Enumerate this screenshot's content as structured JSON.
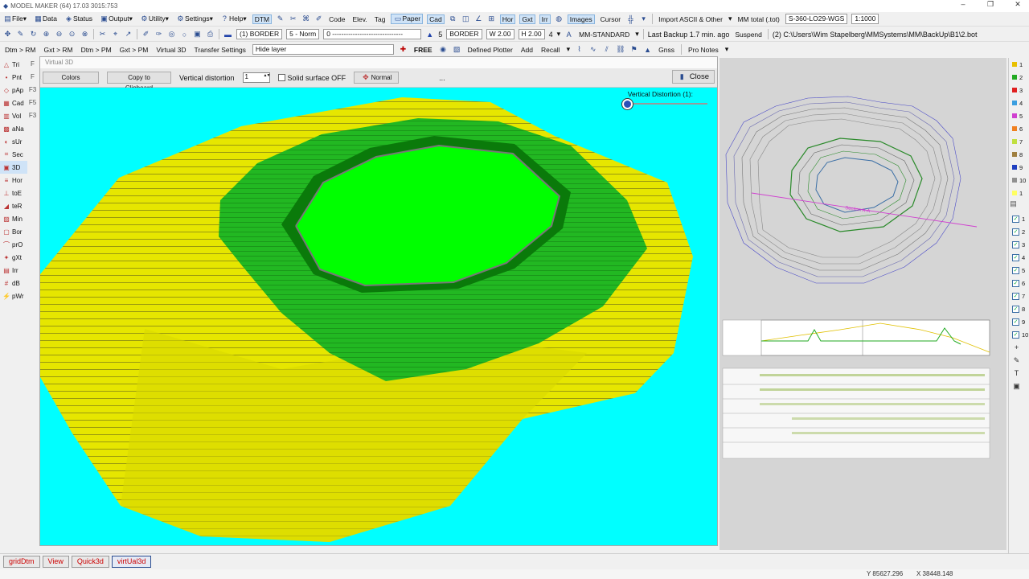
{
  "app": {
    "title": "MODEL MAKER (64)  17.03   3015:753"
  },
  "toolbar1": {
    "file": "File",
    "data": "Data",
    "status": "Status",
    "output": "Output",
    "utility": "Utility",
    "settings": "Settings",
    "help": "Help",
    "dtm": "DTM",
    "code": "Code",
    "elev": "Elev.",
    "tag": "Tag",
    "paper": "Paper",
    "cad": "Cad",
    "hor": "Hor",
    "gxt": "Gxt",
    "irr": "Irr",
    "images": "Images",
    "cursor": "Cursor",
    "import": "Import ASCII & Other",
    "mm_total": "MM total (.tot)",
    "crs": "S-360-LO29-WGS",
    "scale": "1:1000"
  },
  "toolbar2": {
    "layer_combo": "(1) BORDER",
    "style_combo": "5 - Norm",
    "line_combo": "0 -------------------------------",
    "count": "5",
    "border": "BORDER",
    "width": "W 2.00",
    "height": "H 2.00",
    "four": "4",
    "standard": "MM-STANDARD",
    "backup": "Last Backup 1.7 min. ago",
    "suspend": "Suspend",
    "path": "(2) C:\\Users\\Wim Stapelberg\\MMSystems\\MM\\BackUp\\B1\\2.bot"
  },
  "toolbar3": {
    "dtm_rm": "Dtm > RM",
    "gxt_rm": "Gxt > RM",
    "dtm_pm": "Dtm > PM",
    "gxt_pm": "Gxt > PM",
    "virtual3d": "Virtual 3D",
    "transfer": "Transfer Settings",
    "hide_layer": "Hide layer",
    "free": "FREE",
    "defined_plotter": "Defined Plotter",
    "add": "Add",
    "recall": "Recall",
    "gnss": "Gnss",
    "pro_notes": "Pro Notes"
  },
  "left_tools": [
    {
      "icon": "triangle-icon",
      "label": "Tri"
    },
    {
      "icon": "point-icon",
      "label": "Pnt"
    },
    {
      "icon": "pap-icon",
      "label": "pAp"
    },
    {
      "icon": "cad-icon",
      "label": "Cad"
    },
    {
      "icon": "volume-icon",
      "label": "Vol"
    },
    {
      "icon": "ana-icon",
      "label": "aNa"
    },
    {
      "icon": "sur-icon",
      "label": "sUr"
    },
    {
      "icon": "section-icon",
      "label": "Sec"
    },
    {
      "icon": "3d-icon",
      "label": "3D"
    },
    {
      "icon": "hor-icon",
      "label": "Hor"
    },
    {
      "icon": "toe-icon",
      "label": "toE"
    },
    {
      "icon": "ter-icon",
      "label": "teR"
    },
    {
      "icon": "min-icon",
      "label": "Min"
    },
    {
      "icon": "border-icon",
      "label": "Bor"
    },
    {
      "icon": "pro-icon",
      "label": "prO"
    },
    {
      "icon": "gxt-icon",
      "label": "gXt"
    },
    {
      "icon": "irr-icon",
      "label": "Irr"
    },
    {
      "icon": "db-icon",
      "label": "dB"
    },
    {
      "icon": "pwr-icon",
      "label": "pWr"
    }
  ],
  "left_tools2": [
    "F",
    "F",
    "F3",
    "F5",
    "F3"
  ],
  "virtual3d": {
    "window_title": "Virtual 3D",
    "colors": "Colors",
    "copy": "Copy to Clipboard",
    "vdist_label": "Vertical distortion",
    "vdist_value": "1",
    "solid": "Solid surface OFF",
    "normal": "Normal",
    "dots": "...",
    "close": "Close",
    "vd_overlay": "Vertical Distortion (1):"
  },
  "plan": {
    "section_label": "Section A-A"
  },
  "layers": [
    {
      "n": "1",
      "color": "#e8c000"
    },
    {
      "n": "2",
      "color": "#22aa22"
    },
    {
      "n": "3",
      "color": "#e02020"
    },
    {
      "n": "4",
      "color": "#3a9ee0"
    },
    {
      "n": "5",
      "color": "#d040d0"
    },
    {
      "n": "6",
      "color": "#f08020"
    },
    {
      "n": "7",
      "color": "#c0e040"
    },
    {
      "n": "8",
      "color": "#a08040"
    },
    {
      "n": "9",
      "color": "#2040c0"
    },
    {
      "n": "10",
      "color": "#909090"
    },
    {
      "n": "1",
      "color": "#ffff60"
    }
  ],
  "layer_checks": [
    "1",
    "2",
    "3",
    "4",
    "5",
    "6",
    "7",
    "8",
    "9",
    "10"
  ],
  "tabs": [
    "gridDtm",
    "View",
    "Quick3d",
    "virtUal3d"
  ],
  "status": {
    "y": "Y 85627.296",
    "x": "X 38448.148"
  }
}
